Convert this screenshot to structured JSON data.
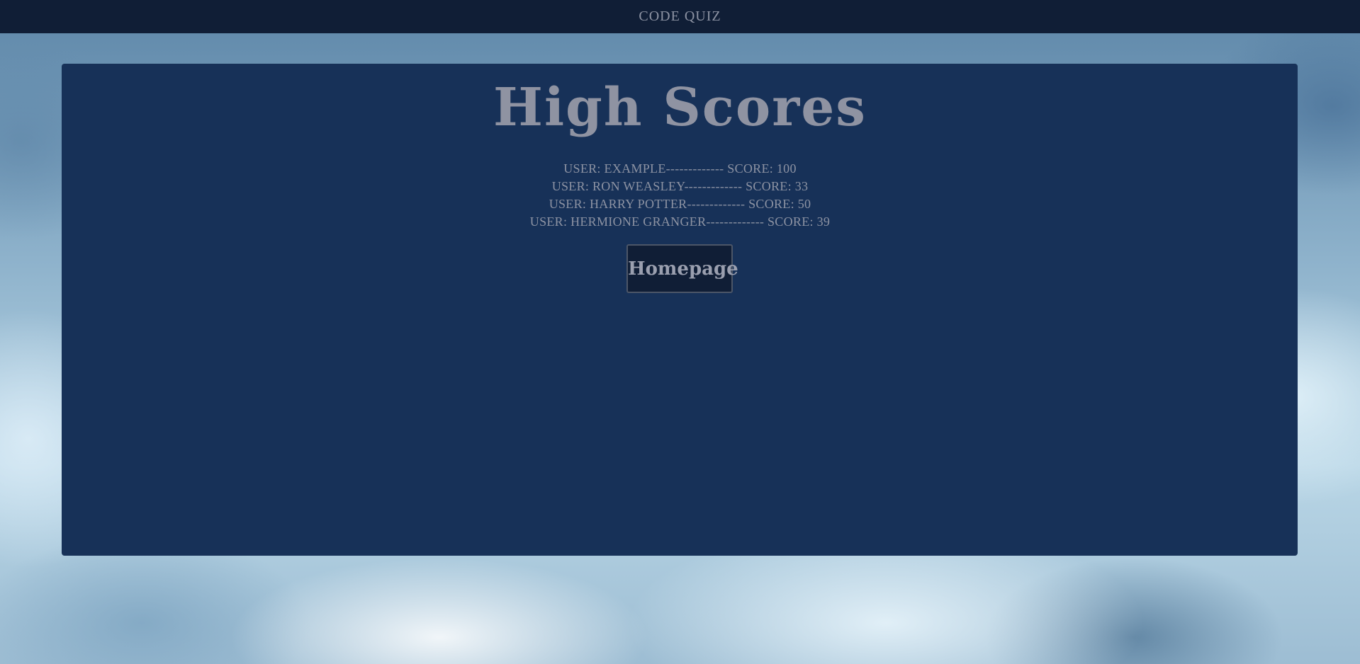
{
  "navbar": {
    "title": "CODE QUIZ"
  },
  "main": {
    "heading": "High Scores",
    "scores": [
      "USER: EXAMPLE------------- SCORE: 100",
      "USER: RON WEASLEY------------- SCORE: 33",
      "USER: HARRY POTTER------------- SCORE: 50",
      "USER: HERMIONE GRANGER------------- SCORE: 39"
    ],
    "homepage_label": "Homepage"
  },
  "colors": {
    "navbar_bg": "#101e36",
    "panel_bg": "#173158",
    "text": "#8d93a3"
  }
}
